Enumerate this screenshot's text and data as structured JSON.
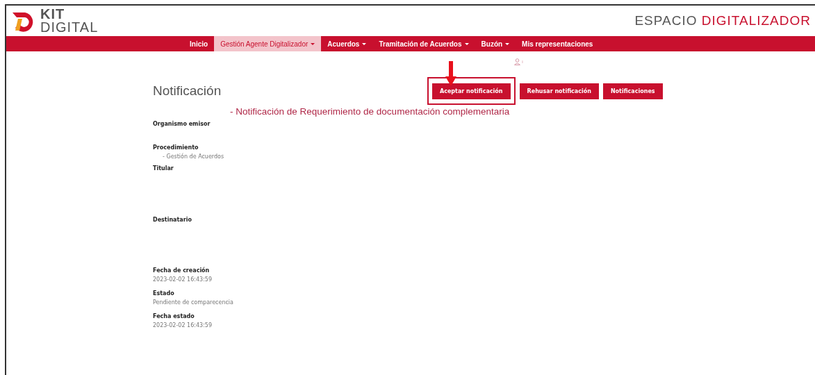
{
  "logo": {
    "line1": "KIT",
    "line2": "DIGITAL"
  },
  "site_title": {
    "part1": "ESPACIO",
    "part2": "DIGITALIZADOR"
  },
  "nav": [
    {
      "label": "Inicio",
      "selected": false,
      "dropdown": false
    },
    {
      "label": "Gestión Agente Digitalizador",
      "selected": true,
      "dropdown": true
    },
    {
      "label": "Acuerdos",
      "selected": false,
      "dropdown": true
    },
    {
      "label": "Tramitación de Acuerdos",
      "selected": false,
      "dropdown": true
    },
    {
      "label": "Buzón",
      "selected": false,
      "dropdown": true
    },
    {
      "label": "Mis representaciones",
      "selected": false,
      "dropdown": false
    }
  ],
  "user_badge": "ı",
  "page_title": "Notificación",
  "actions": [
    {
      "label": "Aceptar notificación",
      "highlighted": true
    },
    {
      "label": "Rehusar notificación",
      "highlighted": false
    },
    {
      "label": "Notificaciones",
      "highlighted": false
    }
  ],
  "subject": "- Notificación de Requerimiento de documentación complementaria",
  "fields": [
    {
      "label": "Organismo emisor"
    },
    {
      "label": "Procedimiento",
      "value": "- Gestión de Acuerdos",
      "indent": true
    },
    {
      "label": "Titular"
    },
    {
      "label": "Destinatario"
    },
    {
      "label": "Fecha de creación",
      "value": "2023-02-02 16:43:59"
    },
    {
      "label": "Estado",
      "value": "Pendiente de comparecencia"
    },
    {
      "label": "Fecha estado",
      "value": "2023-02-02 16:43:59"
    }
  ]
}
